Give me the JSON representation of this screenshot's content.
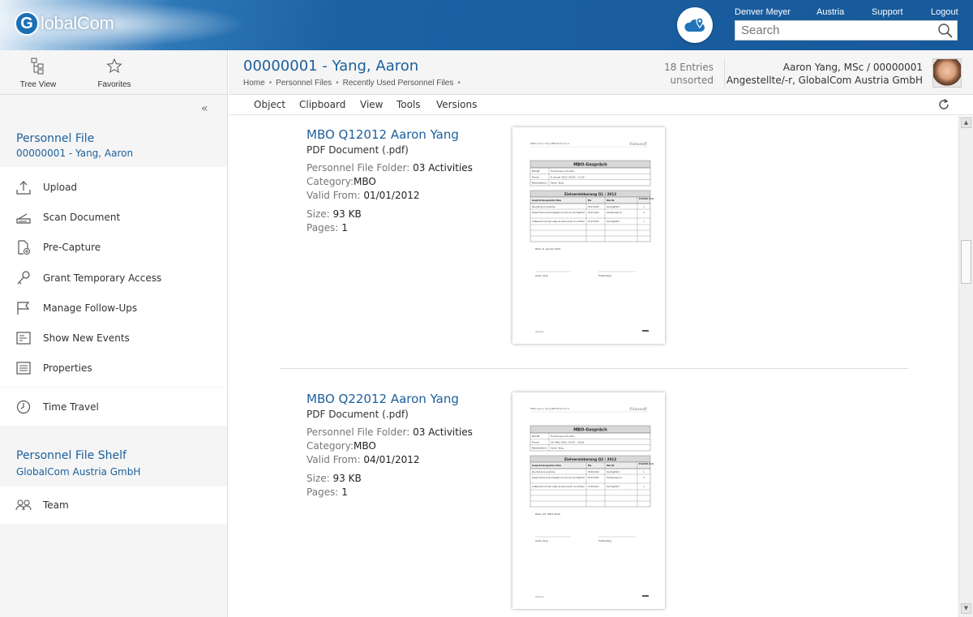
{
  "header": {
    "logo_letter": "G",
    "logo_text": "lobalCom",
    "user": "Denver Meyer",
    "country": "Austria",
    "support": "Support",
    "logout": "Logout",
    "search_placeholder": "Search"
  },
  "sidebar": {
    "tree_view": "Tree View",
    "favorites": "Favorites",
    "personnel_file": {
      "title": "Personnel File",
      "subtitle": "00000001 - Yang, Aaron"
    },
    "items": [
      {
        "label": "Upload",
        "icon": "upload-icon"
      },
      {
        "label": "Scan Document",
        "icon": "scanner-icon"
      },
      {
        "label": "Pre-Capture",
        "icon": "document-add-icon"
      },
      {
        "label": "Grant Temporary Access",
        "icon": "key-icon"
      },
      {
        "label": "Manage Follow-Ups",
        "icon": "flag-icon"
      },
      {
        "label": "Show New Events",
        "icon": "events-icon"
      },
      {
        "label": "Properties",
        "icon": "list-icon"
      }
    ],
    "time_travel": "Time Travel",
    "shelf": {
      "title": "Personnel File Shelf",
      "subtitle": "GlobalCom Austria GmbH"
    },
    "team": "Team"
  },
  "main": {
    "title": "00000001 - Yang, Aaron",
    "breadcrumb": [
      "Home",
      "Personnel Files",
      "Recently Used Personnel Files"
    ],
    "entries_count": "18 Entries",
    "sort_state": "unsorted",
    "person_name": "Aaron Yang, MSc / 00000001",
    "person_role": "Angestellte/-r, GlobalCom Austria GmbH",
    "menu": [
      "Object",
      "Clipboard",
      "View",
      "Tools",
      "Versions"
    ]
  },
  "documents": [
    {
      "name": "MBO Q12012 Aaron Yang",
      "type": "PDF Document (.pdf)",
      "folder_label": "Personnel File Folder:",
      "folder_value": "03 Activities",
      "category_label": "Category:",
      "category_value": "MBO",
      "valid_label": "Valid From:",
      "valid_value": "01/01/2012",
      "size_label": "Size:",
      "size_value": "93 KB",
      "pages_label": "Pages:",
      "pages_value": "1",
      "preview": {
        "header_left": "MBO Aaron Yang MBO2012.docx",
        "brand": "Fabasoft",
        "heading": "MBO-Gespräch",
        "rows": [
          "Betreff",
          "Termin",
          "Mitarbeiter/in"
        ],
        "values": [
          "Forschung und Lehre",
          "6. Januar 2012, 08:00 – 11:00",
          "Aaron Yang"
        ],
        "goals_title": "Zielvereinbarung Q1 / 2012",
        "cols": [
          "Gesprächsergebnis Ziele",
          "Bis",
          "Wer/ib",
          "Priorität (1-3)"
        ],
        "goals": [
          [
            "Das Ziel ist zu erreichen",
            "30.03.2012",
            "Durchgeführt",
            "1"
          ],
          [
            "Dieses Thema wurde folgelegt und wird nun durchgeführt",
            "20.03.2012",
            "Vertrag liegt vor",
            "2"
          ],
          [
            "Außerdem ist auf alles andere auch zu achten",
            "15.03.2012",
            "Durchgeführt",
            "1"
          ]
        ],
        "place_date": "Wien, 6. Januar 2012",
        "sign_left": "Aaron Yang",
        "sign_right": "Tobias Berg",
        "footer": "Intrusion"
      }
    },
    {
      "name": "MBO Q22012 Aaron Yang",
      "type": "PDF Document (.pdf)",
      "folder_label": "Personnel File Folder:",
      "folder_value": "03 Activities",
      "category_label": "Category:",
      "category_value": "MBO",
      "valid_label": "Valid From:",
      "valid_value": "04/01/2012",
      "size_label": "Size:",
      "size_value": "93 KB",
      "pages_label": "Pages:",
      "pages_value": "1",
      "preview": {
        "header_left": "MBO Aaron Yang MBO2012.docx",
        "brand": "Fabasoft",
        "heading": "MBO-Gespräch",
        "rows": [
          "Betreff",
          "Termin",
          "Mitarbeiter/in"
        ],
        "values": [
          "Forschung und Lehre",
          "20. März 2012, 14:00 – 16:00",
          "Aaron Yang"
        ],
        "goals_title": "Zielvereinbarung Q2 / 2012",
        "cols": [
          "Gesprächsergebnis Ziele",
          "Bis",
          "Wer/ib",
          "Priorität (1-3)"
        ],
        "goals": [
          [
            "Das Ziel ist zu erreichen",
            "30.06.2012",
            "Durchgeführt",
            "1"
          ],
          [
            "Dieses Thema wurde folgelegt und wird nun durchgeführt",
            "20.05.2012",
            "Vertrag liegt vor",
            "2"
          ],
          [
            "Außerdem ist auf alles andere auch zu achten",
            "15.06.2012",
            "Durchgeführt",
            "1"
          ]
        ],
        "place_date": "Wien, 20. März 2012",
        "sign_left": "Aaron Yang",
        "sign_right": "Tobias Berg",
        "footer": "Intrusion"
      }
    }
  ]
}
